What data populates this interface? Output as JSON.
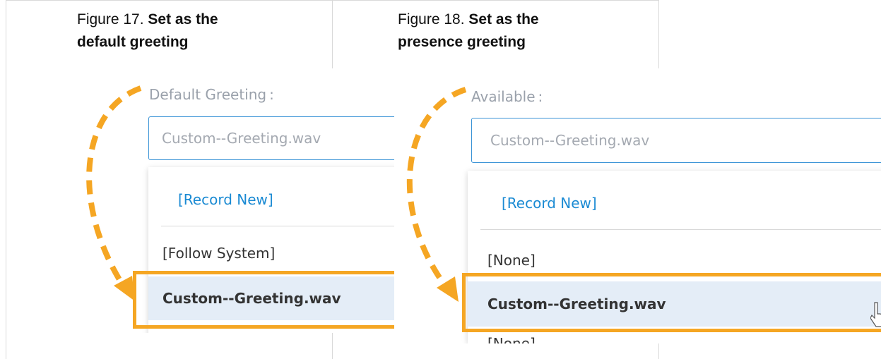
{
  "figures": [
    {
      "caption_number": "Figure 17.",
      "caption_bold_1": "Set as the",
      "caption_bold_2": "default greeting",
      "field_label": "Default Greeting",
      "field_colon": ":",
      "select_value": "Custom--Greeting.wav",
      "record_option": "[Record New]",
      "plain_option": "[Follow System]",
      "selected_option": "Custom--Greeting.wav"
    },
    {
      "caption_number": "Figure 18.",
      "caption_bold_1": "Set as the",
      "caption_bold_2": "presence greeting",
      "field_label": "Available",
      "field_colon": ":",
      "select_value": "Custom--Greeting.wav",
      "record_option": "[Record New]",
      "plain_option": "[None]",
      "selected_option": "Custom--Greeting.wav",
      "partial_option": "[None]"
    }
  ],
  "colors": {
    "accent_orange": "#f5a623",
    "link_blue": "#1a8ad3",
    "select_border": "#3a93d6",
    "selected_row_bg": "#e4edf7"
  }
}
